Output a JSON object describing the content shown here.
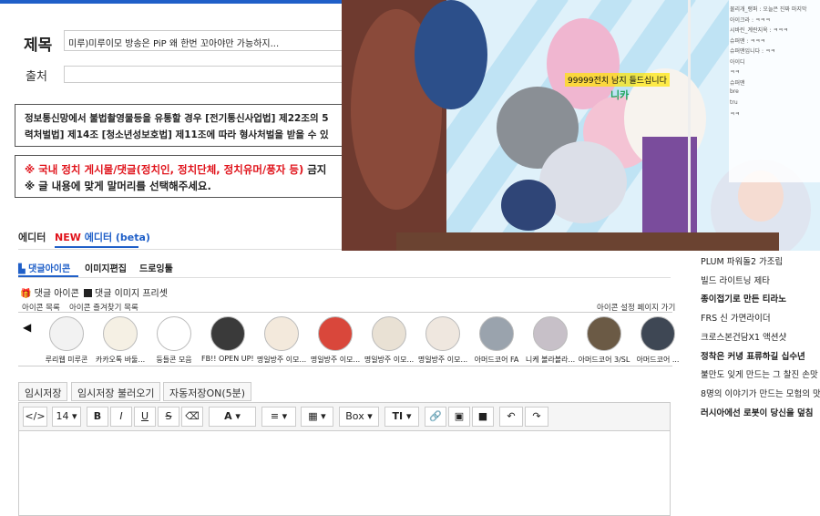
{
  "form": {
    "title_label": "제목",
    "title_value": "미루)미루이모 방송은 PiP 왜 한번 꼬아야만 가능하지...",
    "source_label": "출처"
  },
  "notices": {
    "legal_line1": "정보통신망에서 불법촬영물등을 유통할 경우 [전기통신사업법] 제22조의 5",
    "legal_line2": "력처벌법] 제14조 [청소년성보호법] 제11조에 따라 형사처벌을 받을 수 있",
    "politics_prefix": "※ 국내 정치 게시물/댓글",
    "politics_red": "(정치인, 정치단체, 정치유머/풍자 등)",
    "politics_suffix": " 금지",
    "header_line": "※ 글 내용에 맞게 말머리를 선택해주세요."
  },
  "editor_tabs": {
    "editor": "에디터",
    "new_badge": "NEW",
    "beta": "에디터 (beta)"
  },
  "sub_tabs": {
    "comment_icon": "댓글아이콘",
    "image_edit": "이미지편집",
    "drawing": "드로잉툴"
  },
  "icon_options": {
    "comment_icon_opt": "댓글 아이콘",
    "comment_image_preset": "댓글 이미지 프리셋",
    "icon_list": "아이콘 목록",
    "icon_fav_list": "아이콘 즐겨찾기 목록",
    "icon_settings": "아이콘 설정 페이지 가기"
  },
  "icons": [
    {
      "caption": "루리웹 미루콘",
      "color": "#f2f2f2"
    },
    {
      "caption": "카카오톡 바둘...",
      "color": "#f5f0e4"
    },
    {
      "caption": "둥들콘 모음",
      "color": "#ffffff"
    },
    {
      "caption": "FB!! OPEN UP!!",
      "color": "#3a3a3a"
    },
    {
      "caption": "명일방주 이모...",
      "color": "#f3e9dc"
    },
    {
      "caption": "명일방주 이모...",
      "color": "#d9473b"
    },
    {
      "caption": "명일방주 이모...",
      "color": "#e9e1d4"
    },
    {
      "caption": "명일방주 이모...",
      "color": "#efe7df"
    },
    {
      "caption": "아머드코어 FA",
      "color": "#9aa3ad"
    },
    {
      "caption": "니케 볼라볼라...",
      "color": "#c7c0c8"
    },
    {
      "caption": "아머드코어 3/SL",
      "color": "#6b5a45"
    },
    {
      "caption": "아머드코어 ...",
      "color": "#3e4754"
    }
  ],
  "save_buttons": {
    "temp_save": "임시저장",
    "load_temp": "임시저장 불러오기",
    "auto_save": "자동저장ON(5분)"
  },
  "toolbar": {
    "code": "</>",
    "font_size": "14",
    "bold": "B",
    "italic": "I",
    "underline": "U",
    "strike": "S",
    "eraser": "⌫",
    "font_color": "A",
    "align": "≡",
    "table": "▦",
    "box": "Box",
    "text_style": "TI",
    "link": "🔗",
    "image": "▣",
    "video": "■",
    "undo": "↶",
    "redo": "↷"
  },
  "sidebar": [
    {
      "text": "PLUM 파워돌2 가조립",
      "bold": false
    },
    {
      "text": "빌드 라이트닝 제타",
      "bold": false
    },
    {
      "text": "종이접기로 만든 티라노",
      "bold": true
    },
    {
      "text": "FRS 신 가면라이더",
      "bold": false
    },
    {
      "text": "크로스본건담X1 액션샷",
      "bold": false
    },
    {
      "text": "정착은 커녕 표류하길 십수년",
      "bold": true
    },
    {
      "text": "불만도 잊게 만드는 그 찰진 손맛",
      "bold": false
    },
    {
      "text": "8명의 이야기가 만드는 모험의 맛",
      "bold": false
    },
    {
      "text": "러시아에선 로봇이 당신을 덮침",
      "bold": true
    }
  ],
  "stream_overlay": {
    "banner": "99999전치 남지 들드십니다",
    "name": "니카",
    "chat": [
      "물리개_랭퍼 : 오늘은 진짜 마지막",
      "아이크라 : ㅋㅋㅋ",
      "시바린_계란지옥 : ㅋㅋㅋ",
      "슈퍼맨 : ㅋㅋㅋ",
      "슈퍼맨입니다 : ㅋㅋ",
      "아이디",
      "ㅋㅋ",
      "슈퍼맨",
      "bre",
      "tru",
      "ㅋㅋ"
    ]
  },
  "colors": {
    "accent": "#1f5fc8",
    "alert": "#e0131b"
  }
}
